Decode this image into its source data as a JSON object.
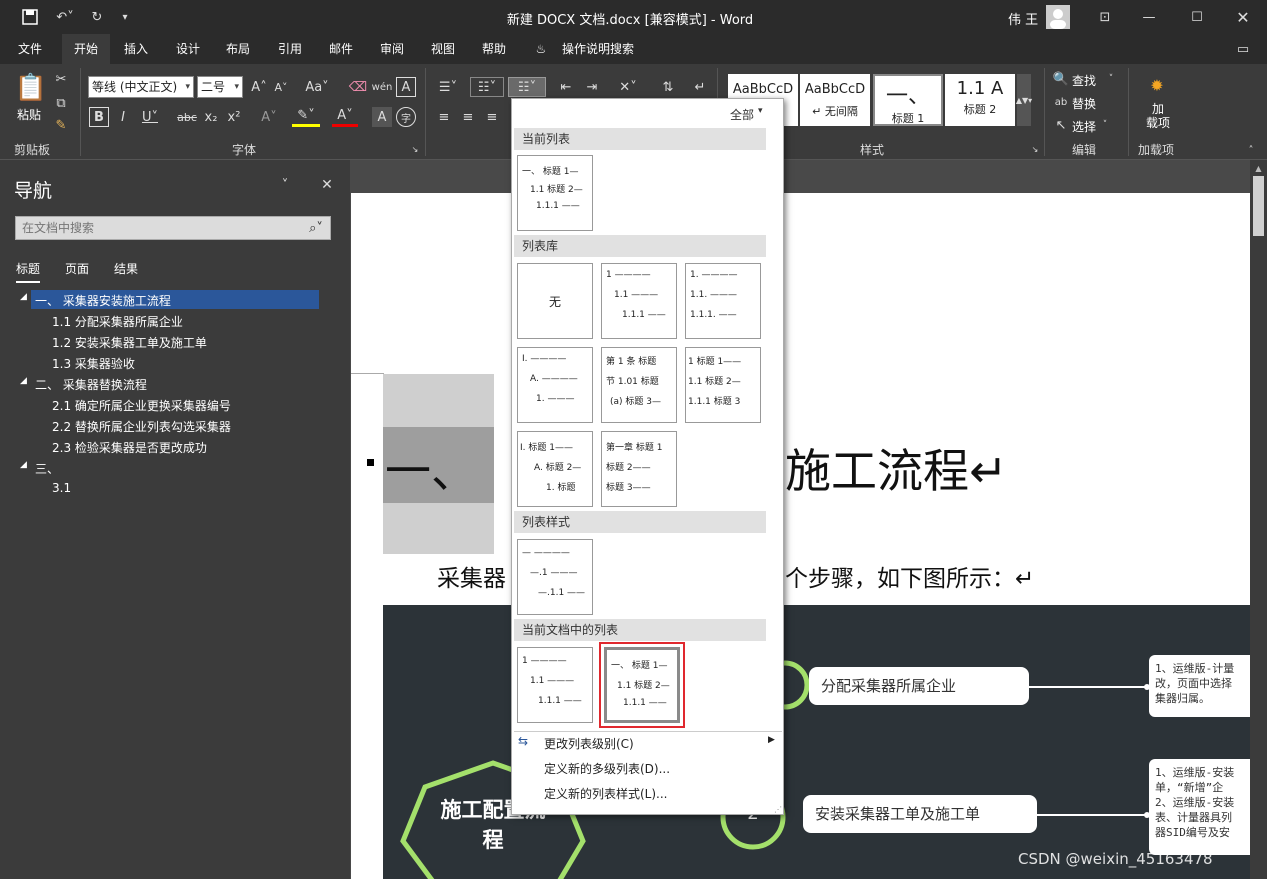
{
  "window": {
    "title": "新建 DOCX 文档.docx [兼容模式] - Word",
    "user": "伟 王"
  },
  "tabs": [
    "文件",
    "开始",
    "插入",
    "设计",
    "布局",
    "引用",
    "邮件",
    "审阅",
    "视图",
    "帮助",
    "操作说明搜索"
  ],
  "ribbon": {
    "clipboard": {
      "paste": "粘贴",
      "group": "剪贴板"
    },
    "font": {
      "name": "等线 (中文正文)",
      "size": "二号",
      "group": "字体"
    },
    "styles": {
      "group": "样式",
      "cards": [
        {
          "preview": "AaBbCcD",
          "name": ""
        },
        {
          "preview": "AaBbCcD",
          "name": "↵ 无间隔"
        },
        {
          "preview": "一、",
          "name": "标题 1"
        },
        {
          "preview": "1.1  A",
          "name": "标题 2"
        }
      ]
    },
    "editing": {
      "find": "查找",
      "replace": "替换",
      "select": "选择",
      "group": "编辑"
    },
    "addins": {
      "label": "加\n载项",
      "group": "加载项"
    }
  },
  "nav": {
    "title": "导航",
    "search_placeholder": "在文档中搜索",
    "tabs": [
      "标题",
      "页面",
      "结果"
    ],
    "items": [
      {
        "text": "一、 采集器安装施工流程",
        "level": 1,
        "selected": true
      },
      {
        "text": "1.1 分配采集器所属企业",
        "level": 2
      },
      {
        "text": "1.2 安装采集器工单及施工单",
        "level": 2
      },
      {
        "text": "1.3 采集器验收",
        "level": 2
      },
      {
        "text": "二、 采集器替换流程",
        "level": 1
      },
      {
        "text": "2.1 确定所属企业更换采集器编号",
        "level": 2
      },
      {
        "text": "2.2 替换所属企业列表勾选采集器",
        "level": 2
      },
      {
        "text": "2.3 检验采集器是否更改成功",
        "level": 2
      },
      {
        "text": "三、",
        "level": 1
      },
      {
        "text": "3.1",
        "level": 2
      }
    ]
  },
  "document": {
    "heading": "一、",
    "heading_suffix": "施工流程↵",
    "para_left": "采集器",
    "para_right": "个步骤，如下图所示：↵",
    "diagram": {
      "center": "施工配置流\n程",
      "node1": "分配采集器所属企业",
      "node2": "安装采集器工单及施工单",
      "num2": "2",
      "note1": "1、运维版-计量\n改，页面中选择\n集器归属。",
      "note2": "1、运维版-安装\n单，“新增”企\n2、运维版-安装\n表、计量器具列\n器SID编号及安"
    }
  },
  "dropdown": {
    "filter": "全部",
    "sections": {
      "current": "当前列表",
      "library": "列表库",
      "styles": "列表样式",
      "in_doc": "当前文档中的列表"
    },
    "none_label": "无",
    "menu": [
      "更改列表级别(C)",
      "定义新的多级列表(D)...",
      "定义新的列表样式(L)..."
    ]
  },
  "watermark": "CSDN @weixin_45163478"
}
